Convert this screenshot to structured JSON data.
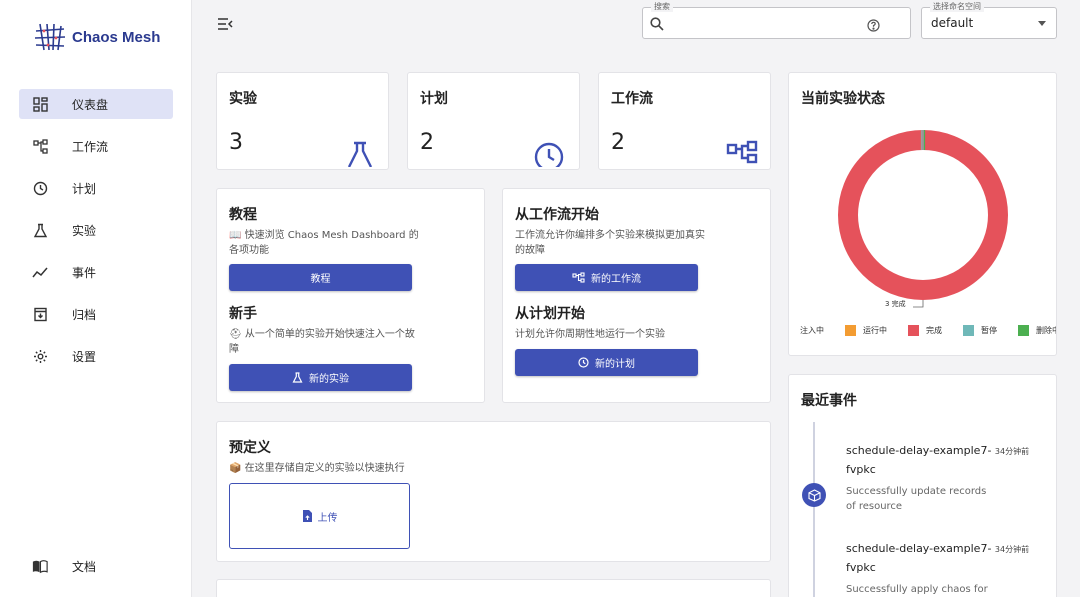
{
  "brand": {
    "name": "Chaos Mesh"
  },
  "sidebar": {
    "items": [
      {
        "label": "仪表盘",
        "icon": "dashboard-icon",
        "active": true
      },
      {
        "label": "工作流",
        "icon": "workflow-icon"
      },
      {
        "label": "计划",
        "icon": "schedule-clock-icon"
      },
      {
        "label": "实验",
        "icon": "flask-icon"
      },
      {
        "label": "事件",
        "icon": "events-chart-icon"
      },
      {
        "label": "归档",
        "icon": "archive-icon"
      },
      {
        "label": "设置",
        "icon": "gear-icon"
      }
    ],
    "docs": {
      "label": "文档",
      "icon": "book-icon"
    }
  },
  "header": {
    "search": {
      "label": "搜索",
      "value": ""
    },
    "namespace": {
      "label": "选择命名空间",
      "value": "default"
    }
  },
  "stats": [
    {
      "title": "实验",
      "value": "3",
      "icon": "flask-icon"
    },
    {
      "title": "计划",
      "value": "2",
      "icon": "clock-icon"
    },
    {
      "title": "工作流",
      "value": "2",
      "icon": "workflow-icon"
    }
  ],
  "tutorial": {
    "title": "教程",
    "desc": "📖 快速浏览 Chaos Mesh Dashboard 的各项功能",
    "button": "教程",
    "newbie_title": "新手",
    "newbie_desc": "⛑ 从一个简单的实验开始快速注入一个故障",
    "newbie_button": "新的实验"
  },
  "start": {
    "workflow_title": "从工作流开始",
    "workflow_desc": "工作流允许你编排多个实验来模拟更加真实的故障",
    "workflow_button": "新的工作流",
    "schedule_title": "从计划开始",
    "schedule_desc": "计划允许你周期性地运行一个实验",
    "schedule_button": "新的计划"
  },
  "predefined": {
    "title": "预定义",
    "desc": "📦 在这里存储自定义的实验以快速执行",
    "upload": "上传"
  },
  "status": {
    "title": "当前实验状态",
    "callout": "3 完成",
    "legend": [
      {
        "label": "注入中",
        "color": "#9e9e9e"
      },
      {
        "label": "运行中",
        "color": "#f39c32"
      },
      {
        "label": "完成",
        "color": "#e5525b"
      },
      {
        "label": "暂停",
        "color": "#6fb8b8"
      },
      {
        "label": "删除中",
        "color": "#4caf50"
      }
    ]
  },
  "chart_data": {
    "type": "pie",
    "categories": [
      "注入中",
      "运行中",
      "完成",
      "暂停",
      "删除中"
    ],
    "values": [
      0,
      0,
      3,
      0,
      0
    ],
    "colors": [
      "#9e9e9e",
      "#f39c32",
      "#e5525b",
      "#6fb8b8",
      "#4caf50"
    ],
    "title": "当前实验状态",
    "legend_position": "bottom"
  },
  "events": {
    "title": "最近事件",
    "items": [
      {
        "name_line1": "schedule-delay-example7-",
        "name_line2": "fvpkc",
        "time": "34分钟前",
        "message_line1": "Successfully update records",
        "message_line2": "of resource"
      },
      {
        "name_line1": "schedule-delay-example7-",
        "name_line2": "fvpkc",
        "time": "34分钟前",
        "message_line1": "Successfully apply chaos for",
        "message_line2": ""
      }
    ]
  }
}
